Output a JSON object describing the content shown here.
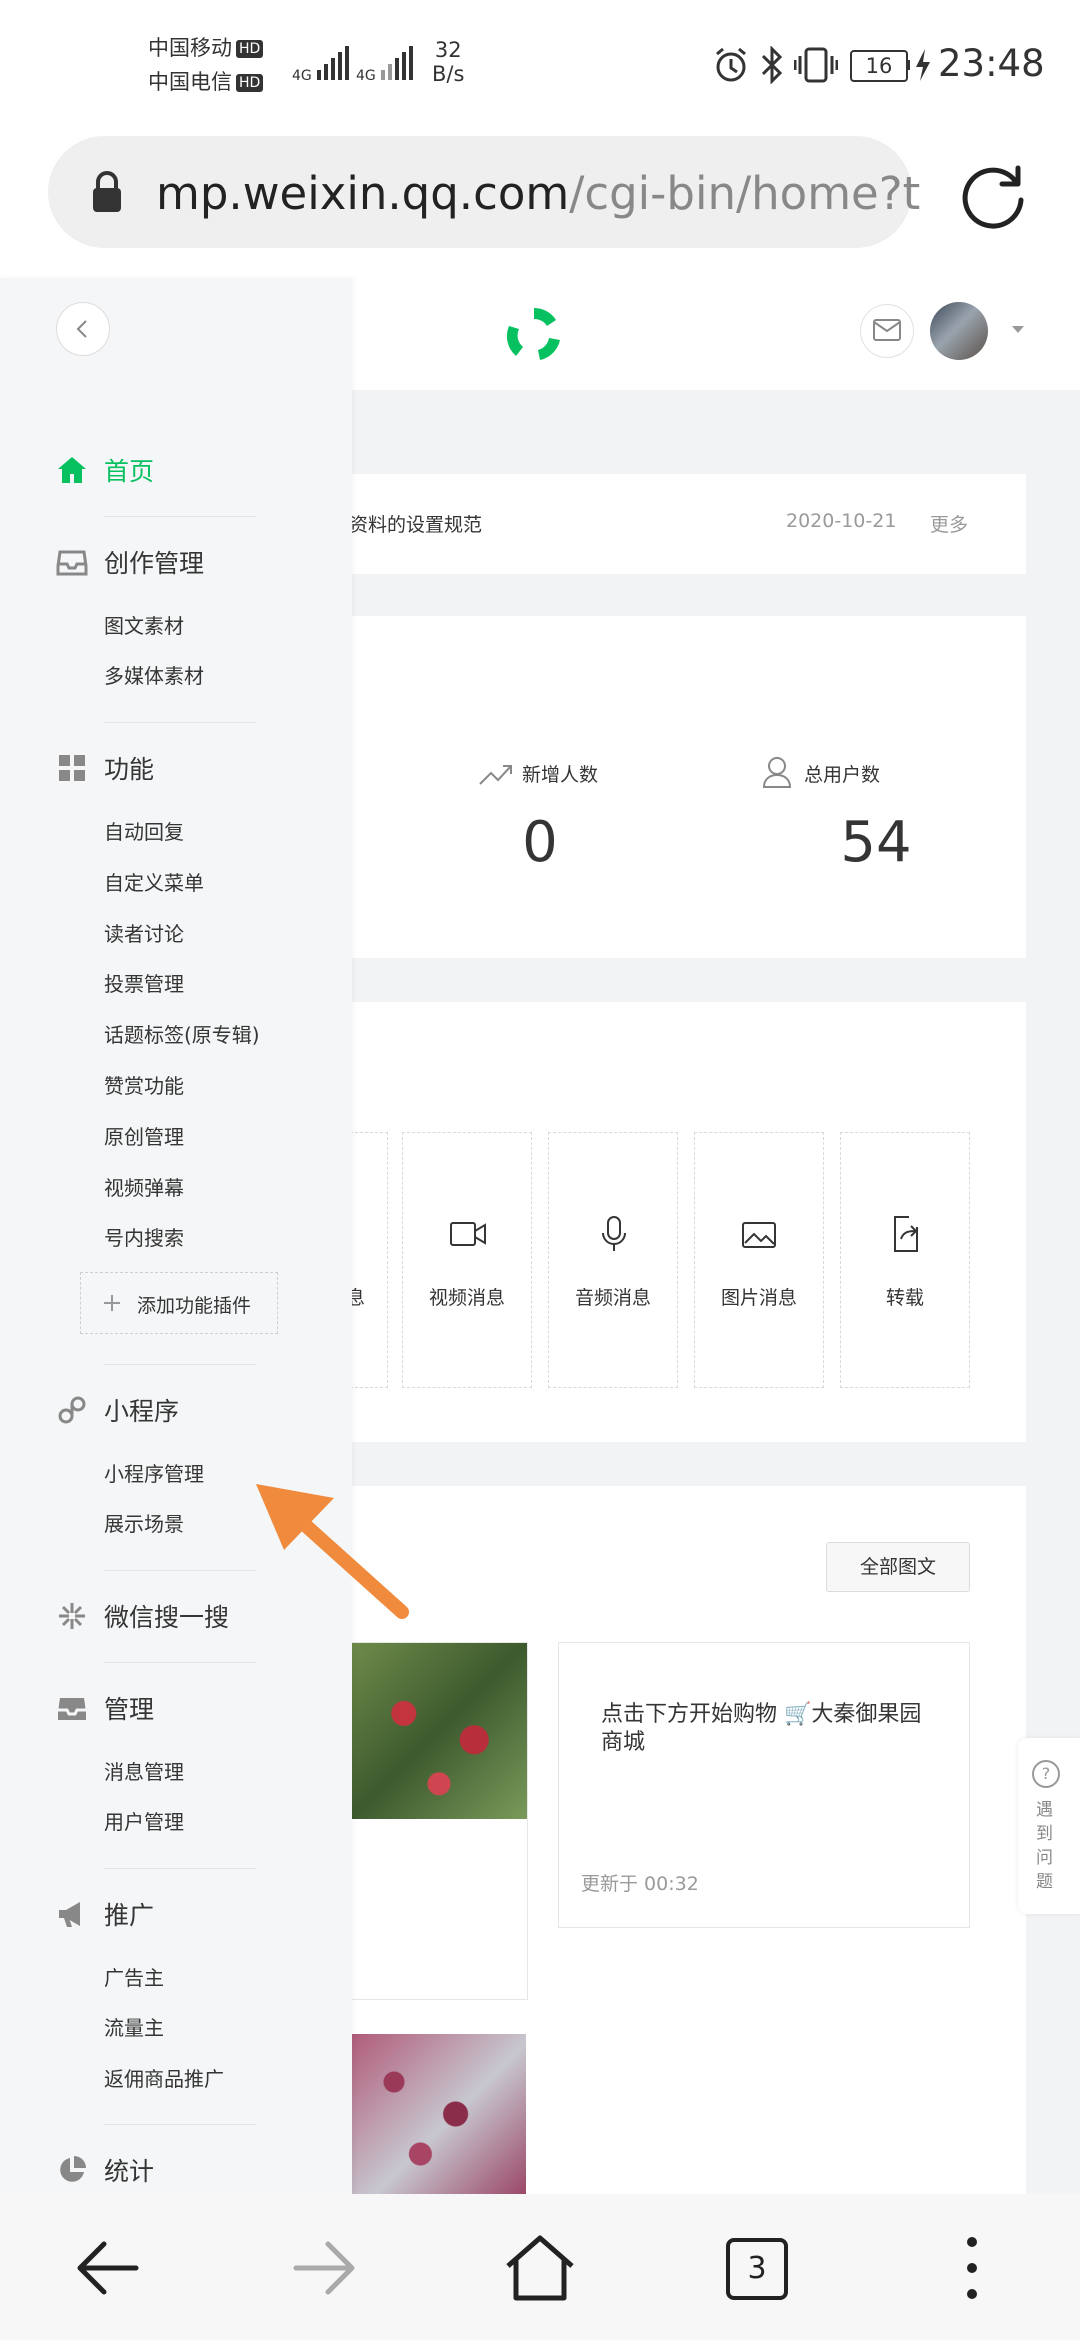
{
  "status": {
    "carrier1": "中国移动",
    "carrier2": "中国电信",
    "hd": "HD",
    "net": "4G",
    "speed_value": "32",
    "speed_unit": "B/s",
    "battery": "16",
    "time": "23:48"
  },
  "browser": {
    "url_host": "mp.weixin.qq.com",
    "url_path": "/cgi-bin/home?t",
    "tab_count": "3"
  },
  "notice": {
    "text": "号资料的设置规范",
    "date": "2020-10-21",
    "more": "更多"
  },
  "stats": [
    {
      "label": "新增人数",
      "value": "0",
      "icon": "trend-up-icon"
    },
    {
      "label": "总用户数",
      "value": "54",
      "icon": "user-icon"
    }
  ],
  "create": {
    "partial_label": "息",
    "items": [
      {
        "label": "视频消息",
        "icon": "video-icon"
      },
      {
        "label": "音频消息",
        "icon": "mic-icon"
      },
      {
        "label": "图片消息",
        "icon": "image-icon"
      },
      {
        "label": "转载",
        "icon": "share-icon"
      }
    ]
  },
  "articles": {
    "all_button": "全部图文",
    "article_text": "点击下方开始购物 🛒大秦御果园商城",
    "updated": "更新于 00:32"
  },
  "help": {
    "label": "遇到问题"
  },
  "sidebar": {
    "home": "首页",
    "creation": "创作管理",
    "creation_items": [
      "图文素材",
      "多媒体素材"
    ],
    "features": "功能",
    "feature_items": [
      "自动回复",
      "自定义菜单",
      "读者讨论",
      "投票管理",
      "话题标签(原专辑)",
      "赞赏功能",
      "原创管理",
      "视频弹幕",
      "号内搜索"
    ],
    "add_plugin": "添加功能插件",
    "miniprogram": "小程序",
    "mini_items": [
      "小程序管理",
      "展示场景"
    ],
    "search": "微信搜一搜",
    "manage": "管理",
    "manage_items": [
      "消息管理",
      "用户管理"
    ],
    "promote": "推广",
    "promote_items": [
      "广告主",
      "流量主",
      "返佣商品推广"
    ],
    "stats": "统计"
  },
  "colors": {
    "accent": "#07c160",
    "arrow": "#f08a3c"
  }
}
